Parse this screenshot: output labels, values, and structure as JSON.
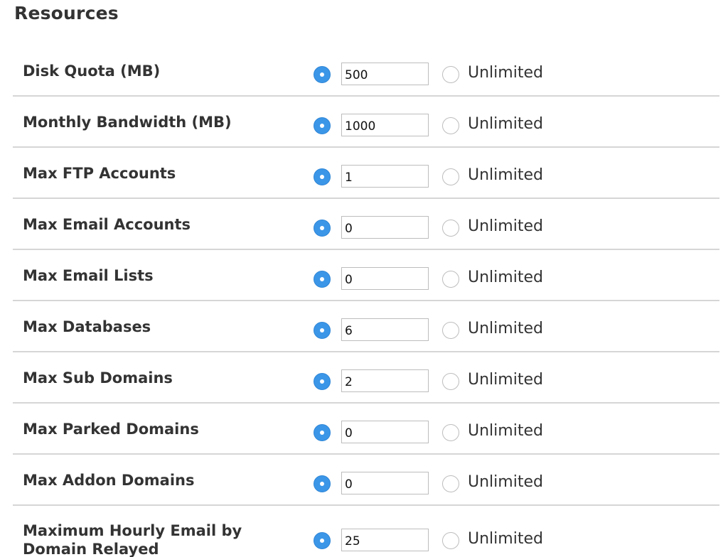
{
  "section": {
    "title": "Resources"
  },
  "unlimited_label": "Unlimited",
  "colors": {
    "radio_checked": "#3b96e8",
    "divider": "#d6d6d6",
    "text": "#333333"
  },
  "rows": [
    {
      "label": "Disk Quota (MB)",
      "value": "500",
      "selected": "value"
    },
    {
      "label": "Monthly Bandwidth (MB)",
      "value": "1000",
      "selected": "value"
    },
    {
      "label": "Max FTP Accounts",
      "value": "1",
      "selected": "value"
    },
    {
      "label": "Max Email Accounts",
      "value": "0",
      "selected": "value"
    },
    {
      "label": "Max Email Lists",
      "value": "0",
      "selected": "value"
    },
    {
      "label": "Max Databases",
      "value": "6",
      "selected": "value"
    },
    {
      "label": "Max Sub Domains",
      "value": "2",
      "selected": "value"
    },
    {
      "label": "Max Parked Domains",
      "value": "0",
      "selected": "value"
    },
    {
      "label": "Max Addon Domains",
      "value": "0",
      "selected": "value"
    },
    {
      "label": "Maximum Hourly Email by Domain Relayed",
      "value": "25",
      "selected": "value"
    }
  ]
}
